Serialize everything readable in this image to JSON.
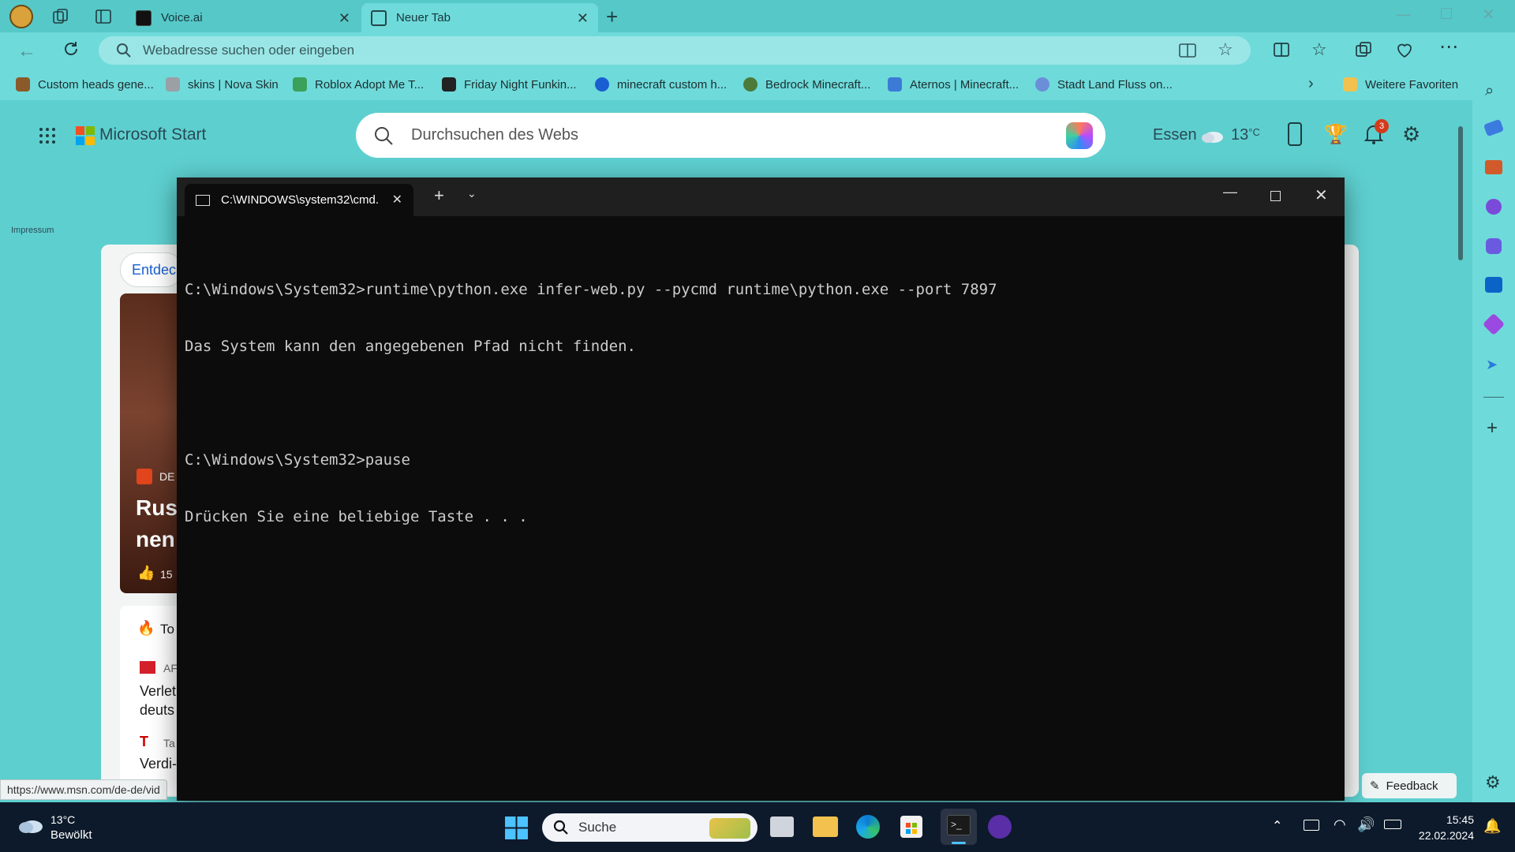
{
  "browser": {
    "tabs": [
      {
        "label": "Voice.ai"
      },
      {
        "label": "Neuer Tab"
      }
    ],
    "address_placeholder": "Webadresse suchen oder eingeben",
    "favorites": [
      {
        "label": "Custom heads gene...",
        "color": "#8a5a2b"
      },
      {
        "label": "skins | Nova Skin",
        "color": "#9aa0a6"
      },
      {
        "label": "Roblox Adopt Me T...",
        "color": "#3aa05a"
      },
      {
        "label": "Friday Night Funkin...",
        "color": "#222222"
      },
      {
        "label": "minecraft custom h...",
        "color": "#1a5fd1"
      },
      {
        "label": "Bedrock Minecraft...",
        "color": "#4c7a3a"
      },
      {
        "label": "Aternos | Minecraft...",
        "color": "#3b7bd6"
      },
      {
        "label": "Stadt Land Fluss on...",
        "color": "#6a8fd8"
      }
    ],
    "more_favorites": "Weitere Favoriten",
    "status_url": "https://www.msn.com/de-de/vid"
  },
  "msn": {
    "brand": "Microsoft Start",
    "search_placeholder": "Durchsuchen des Webs",
    "weather_city": "Essen",
    "weather_temp": "13",
    "weather_unit": "°C",
    "notification_count": "3",
    "impressum": "Impressum",
    "entdecken": "Entdec",
    "card_source": "DE",
    "card_title_1": "Rus",
    "card_title_2": "nen",
    "card_likes": "15",
    "top_label": "To",
    "news1_source": "AF",
    "news1_line1": "Verlet",
    "news1_line2": "deuts",
    "news2_source": "Ta",
    "news2_line1": "Verdi-",
    "feedback": "Feedback"
  },
  "terminal": {
    "tab_title": "C:\\WINDOWS\\system32\\cmd.",
    "lines": [
      "C:\\Windows\\System32>runtime\\python.exe infer-web.py --pycmd runtime\\python.exe --port 7897",
      "Das System kann den angegebenen Pfad nicht finden.",
      "",
      "C:\\Windows\\System32>pause",
      "Drücken Sie eine beliebige Taste . . ."
    ]
  },
  "taskbar": {
    "weather_temp": "13°C",
    "weather_desc": "Bewölkt",
    "search_label": "Suche",
    "time": "15:45",
    "date": "22.02.2024"
  }
}
